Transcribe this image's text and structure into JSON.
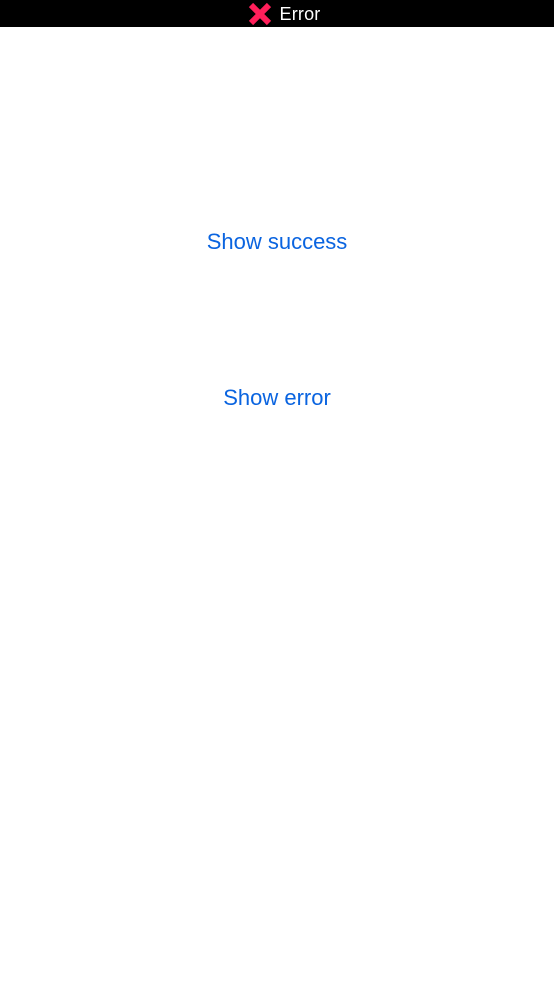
{
  "status_bar": {
    "icon": "close-icon",
    "text": "Error",
    "icon_color": "#ff1f5a",
    "background": "#000000"
  },
  "main": {
    "show_success_label": "Show success",
    "show_error_label": "Show error",
    "link_color": "#0a64e0"
  }
}
